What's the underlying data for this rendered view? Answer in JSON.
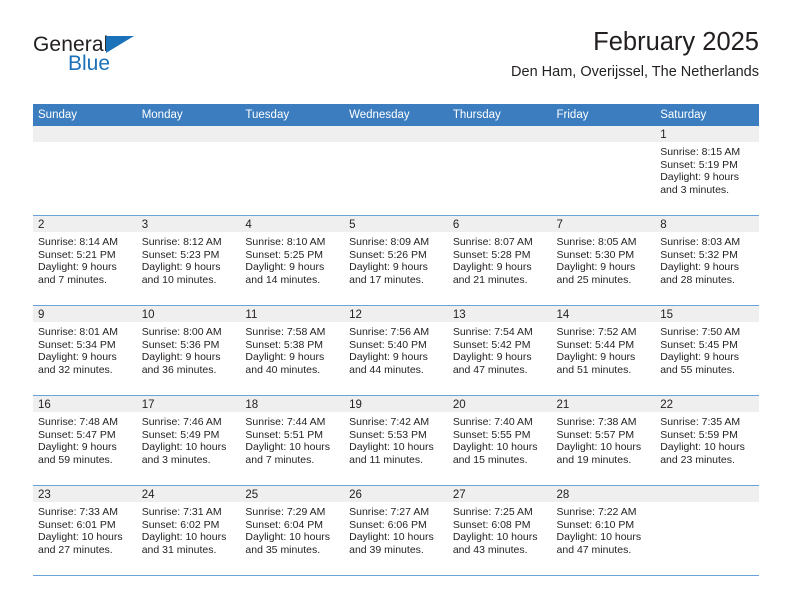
{
  "logo": {
    "word_top": "General",
    "word_bottom": "Blue",
    "accent_color": "#1b72b8"
  },
  "header": {
    "title": "February 2025",
    "subtitle": "Den Ham, Overijssel, The Netherlands"
  },
  "theme": {
    "header_blue": "#3b7dbf",
    "grid_line": "#6ba3d6",
    "daynum_band": "#efefef",
    "text": "#231f20"
  },
  "calendar": {
    "weekday_headers": [
      "Sunday",
      "Monday",
      "Tuesday",
      "Wednesday",
      "Thursday",
      "Friday",
      "Saturday"
    ],
    "labels": {
      "sunrise": "Sunrise:",
      "sunset": "Sunset:",
      "daylight": "Daylight:"
    },
    "weeks": [
      [
        {
          "day": "",
          "empty": true
        },
        {
          "day": "",
          "empty": true
        },
        {
          "day": "",
          "empty": true
        },
        {
          "day": "",
          "empty": true
        },
        {
          "day": "",
          "empty": true
        },
        {
          "day": "",
          "empty": true
        },
        {
          "day": "1",
          "sunrise": "Sunrise: 8:15 AM",
          "sunset": "Sunset: 5:19 PM",
          "daylight": "Daylight: 9 hours and 3 minutes."
        }
      ],
      [
        {
          "day": "2",
          "sunrise": "Sunrise: 8:14 AM",
          "sunset": "Sunset: 5:21 PM",
          "daylight": "Daylight: 9 hours and 7 minutes."
        },
        {
          "day": "3",
          "sunrise": "Sunrise: 8:12 AM",
          "sunset": "Sunset: 5:23 PM",
          "daylight": "Daylight: 9 hours and 10 minutes."
        },
        {
          "day": "4",
          "sunrise": "Sunrise: 8:10 AM",
          "sunset": "Sunset: 5:25 PM",
          "daylight": "Daylight: 9 hours and 14 minutes."
        },
        {
          "day": "5",
          "sunrise": "Sunrise: 8:09 AM",
          "sunset": "Sunset: 5:26 PM",
          "daylight": "Daylight: 9 hours and 17 minutes."
        },
        {
          "day": "6",
          "sunrise": "Sunrise: 8:07 AM",
          "sunset": "Sunset: 5:28 PM",
          "daylight": "Daylight: 9 hours and 21 minutes."
        },
        {
          "day": "7",
          "sunrise": "Sunrise: 8:05 AM",
          "sunset": "Sunset: 5:30 PM",
          "daylight": "Daylight: 9 hours and 25 minutes."
        },
        {
          "day": "8",
          "sunrise": "Sunrise: 8:03 AM",
          "sunset": "Sunset: 5:32 PM",
          "daylight": "Daylight: 9 hours and 28 minutes."
        }
      ],
      [
        {
          "day": "9",
          "sunrise": "Sunrise: 8:01 AM",
          "sunset": "Sunset: 5:34 PM",
          "daylight": "Daylight: 9 hours and 32 minutes."
        },
        {
          "day": "10",
          "sunrise": "Sunrise: 8:00 AM",
          "sunset": "Sunset: 5:36 PM",
          "daylight": "Daylight: 9 hours and 36 minutes."
        },
        {
          "day": "11",
          "sunrise": "Sunrise: 7:58 AM",
          "sunset": "Sunset: 5:38 PM",
          "daylight": "Daylight: 9 hours and 40 minutes."
        },
        {
          "day": "12",
          "sunrise": "Sunrise: 7:56 AM",
          "sunset": "Sunset: 5:40 PM",
          "daylight": "Daylight: 9 hours and 44 minutes."
        },
        {
          "day": "13",
          "sunrise": "Sunrise: 7:54 AM",
          "sunset": "Sunset: 5:42 PM",
          "daylight": "Daylight: 9 hours and 47 minutes."
        },
        {
          "day": "14",
          "sunrise": "Sunrise: 7:52 AM",
          "sunset": "Sunset: 5:44 PM",
          "daylight": "Daylight: 9 hours and 51 minutes."
        },
        {
          "day": "15",
          "sunrise": "Sunrise: 7:50 AM",
          "sunset": "Sunset: 5:45 PM",
          "daylight": "Daylight: 9 hours and 55 minutes."
        }
      ],
      [
        {
          "day": "16",
          "sunrise": "Sunrise: 7:48 AM",
          "sunset": "Sunset: 5:47 PM",
          "daylight": "Daylight: 9 hours and 59 minutes."
        },
        {
          "day": "17",
          "sunrise": "Sunrise: 7:46 AM",
          "sunset": "Sunset: 5:49 PM",
          "daylight": "Daylight: 10 hours and 3 minutes."
        },
        {
          "day": "18",
          "sunrise": "Sunrise: 7:44 AM",
          "sunset": "Sunset: 5:51 PM",
          "daylight": "Daylight: 10 hours and 7 minutes."
        },
        {
          "day": "19",
          "sunrise": "Sunrise: 7:42 AM",
          "sunset": "Sunset: 5:53 PM",
          "daylight": "Daylight: 10 hours and 11 minutes."
        },
        {
          "day": "20",
          "sunrise": "Sunrise: 7:40 AM",
          "sunset": "Sunset: 5:55 PM",
          "daylight": "Daylight: 10 hours and 15 minutes."
        },
        {
          "day": "21",
          "sunrise": "Sunrise: 7:38 AM",
          "sunset": "Sunset: 5:57 PM",
          "daylight": "Daylight: 10 hours and 19 minutes."
        },
        {
          "day": "22",
          "sunrise": "Sunrise: 7:35 AM",
          "sunset": "Sunset: 5:59 PM",
          "daylight": "Daylight: 10 hours and 23 minutes."
        }
      ],
      [
        {
          "day": "23",
          "sunrise": "Sunrise: 7:33 AM",
          "sunset": "Sunset: 6:01 PM",
          "daylight": "Daylight: 10 hours and 27 minutes."
        },
        {
          "day": "24",
          "sunrise": "Sunrise: 7:31 AM",
          "sunset": "Sunset: 6:02 PM",
          "daylight": "Daylight: 10 hours and 31 minutes."
        },
        {
          "day": "25",
          "sunrise": "Sunrise: 7:29 AM",
          "sunset": "Sunset: 6:04 PM",
          "daylight": "Daylight: 10 hours and 35 minutes."
        },
        {
          "day": "26",
          "sunrise": "Sunrise: 7:27 AM",
          "sunset": "Sunset: 6:06 PM",
          "daylight": "Daylight: 10 hours and 39 minutes."
        },
        {
          "day": "27",
          "sunrise": "Sunrise: 7:25 AM",
          "sunset": "Sunset: 6:08 PM",
          "daylight": "Daylight: 10 hours and 43 minutes."
        },
        {
          "day": "28",
          "sunrise": "Sunrise: 7:22 AM",
          "sunset": "Sunset: 6:10 PM",
          "daylight": "Daylight: 10 hours and 47 minutes."
        },
        {
          "day": "",
          "empty": true
        }
      ]
    ]
  }
}
